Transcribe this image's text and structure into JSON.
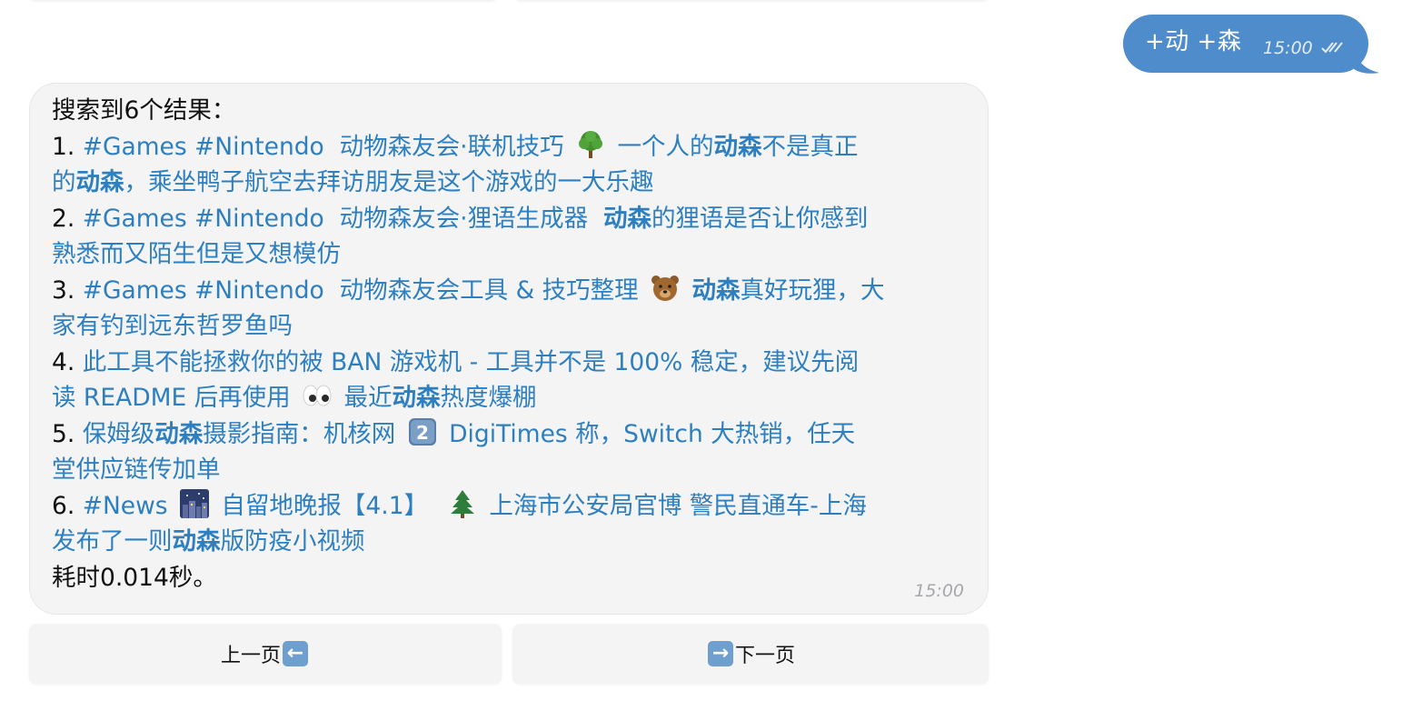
{
  "outgoing": {
    "text": "+动 +森",
    "time": "15:00"
  },
  "incoming": {
    "header": "搜索到6个结果：",
    "results": [
      {
        "num": "1.",
        "tags": "#Games #Nintendo",
        "channel": "动物森友会·联机技巧",
        "emoji": "tree-icon",
        "pre": "一个人的",
        "kw": "动森",
        "mid": "不是真正",
        "line2pre": "的",
        "kw2": "动森",
        "line2post": "，乘坐鸭子航空去拜访朋友是这个游戏的一大乐趣"
      },
      {
        "num": "2.",
        "tags": "#Games #Nintendo",
        "channel": "动物森友会·狸语生成器",
        "kw": "动森",
        "post": "的狸语是否让你感到",
        "line2": "熟悉而又陌生但是又想模仿"
      },
      {
        "num": "3.",
        "tags": "#Games #Nintendo",
        "channel": "动物森友会工具 & 技巧整理",
        "emoji": "bear-icon",
        "kw": "动森",
        "post": "真好玩狸，大",
        "line2": "家有钓到远东哲罗鱼吗"
      },
      {
        "num": "4.",
        "text": "此工具不能拯救你的被 BAN 游戏机 - 工具并不是 100% 稳定，建议先阅",
        "line2pre": "读 README 后再使用",
        "emoji": "eyes-icon",
        "line2mid": "最近",
        "kw": "动森",
        "line2post": "热度爆棚"
      },
      {
        "num": "5.",
        "pre": "保姆级",
        "kw": "动森",
        "post": "摄影指南：机核网",
        "emoji": "keycap-2-icon",
        "text2": "DigiTimes 称，Switch 大热销，任天",
        "line2": "堂供应链传加单"
      },
      {
        "num": "6.",
        "tags": "#News",
        "emoji": "night-city-icon",
        "channel": "自留地晚报【4.1】",
        "emoji2": "evergreen-tree-icon",
        "text2": "上海市公安局官博 警民直通车-上海",
        "line2pre": "发布了一则",
        "kw": "动森",
        "line2post": "版防疫小视频"
      }
    ],
    "footer": "耗时0.014秒。",
    "time": "15:00"
  },
  "keyboard": {
    "prev_label": "上一页",
    "next_label": "下一页",
    "prev_icon": "left-arrow-icon",
    "next_icon": "right-arrow-icon"
  },
  "colors": {
    "outgoing_bubble": "#4f8ccc",
    "link": "#2d7fbf",
    "incoming_bubble": "#f4f4f5"
  }
}
